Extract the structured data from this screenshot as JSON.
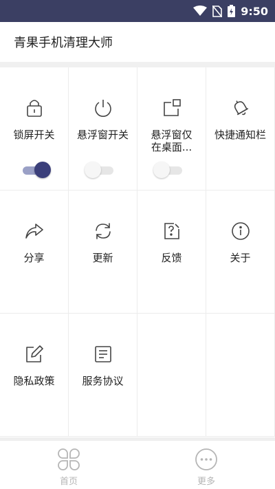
{
  "status_bar": {
    "time": "9:50",
    "icons": [
      "wifi-icon",
      "no-sim-icon",
      "battery-charging-icon"
    ]
  },
  "header": {
    "title": "青果手机清理大师"
  },
  "colors": {
    "status_bar": "#3b3f63",
    "toggle_on_knob": "#3b3f7a",
    "toggle_on_track": "#9aa0c6",
    "icon_stroke": "#444444",
    "nav_inactive": "#b5b5b5"
  },
  "grid": {
    "items": [
      {
        "label": "锁屏开关",
        "icon": "lock-icon",
        "toggle": {
          "state": "on"
        }
      },
      {
        "label": "悬浮窗开关",
        "icon": "power-icon",
        "toggle": {
          "state": "off"
        }
      },
      {
        "label": "悬浮窗仅在桌面...",
        "label_line1": "悬浮窗仅",
        "label_line2": "在桌面...",
        "icon": "window-icon",
        "toggle": {
          "state": "off"
        }
      },
      {
        "label": "快捷通知栏",
        "icon": "bell-icon"
      },
      {
        "label": "分享",
        "icon": "share-icon"
      },
      {
        "label": "更新",
        "icon": "refresh-icon"
      },
      {
        "label": "反馈",
        "icon": "feedback-icon"
      },
      {
        "label": "关于",
        "icon": "info-icon"
      },
      {
        "label": "隐私政策",
        "icon": "edit-icon"
      },
      {
        "label": "服务协议",
        "icon": "document-icon"
      }
    ]
  },
  "bottom_nav": {
    "items": [
      {
        "label": "首页",
        "icon": "clover-icon"
      },
      {
        "label": "更多",
        "icon": "more-icon"
      }
    ]
  }
}
